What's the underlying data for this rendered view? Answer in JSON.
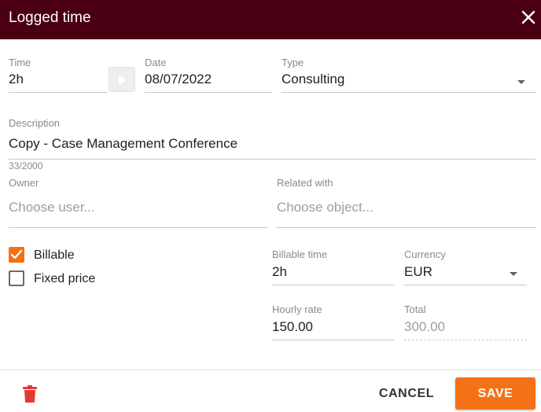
{
  "dialog": {
    "title": "Logged time",
    "close_icon": "close-icon"
  },
  "form": {
    "time": {
      "label": "Time",
      "value": "2h"
    },
    "date": {
      "label": "Date",
      "value": "08/07/2022"
    },
    "type": {
      "label": "Type",
      "value": "Consulting"
    },
    "description": {
      "label": "Description",
      "value": "Copy - Case Management Conference",
      "counter": "33/2000"
    },
    "owner": {
      "label": "Owner",
      "placeholder": "Choose user..."
    },
    "related_with": {
      "label": "Related with",
      "placeholder": "Choose object..."
    },
    "billable": {
      "label": "Billable",
      "checked": true
    },
    "fixed_price": {
      "label": "Fixed price",
      "checked": false
    },
    "billable_time": {
      "label": "Billable time",
      "value": "2h"
    },
    "currency": {
      "label": "Currency",
      "value": "EUR"
    },
    "hourly_rate": {
      "label": "Hourly rate",
      "value": "150.00"
    },
    "total": {
      "label": "Total",
      "value": "300.00"
    }
  },
  "footer": {
    "delete_icon": "trash-icon",
    "cancel_label": "CANCEL",
    "save_label": "SAVE"
  },
  "colors": {
    "header_bg": "#4a0012",
    "accent": "#f47216"
  }
}
